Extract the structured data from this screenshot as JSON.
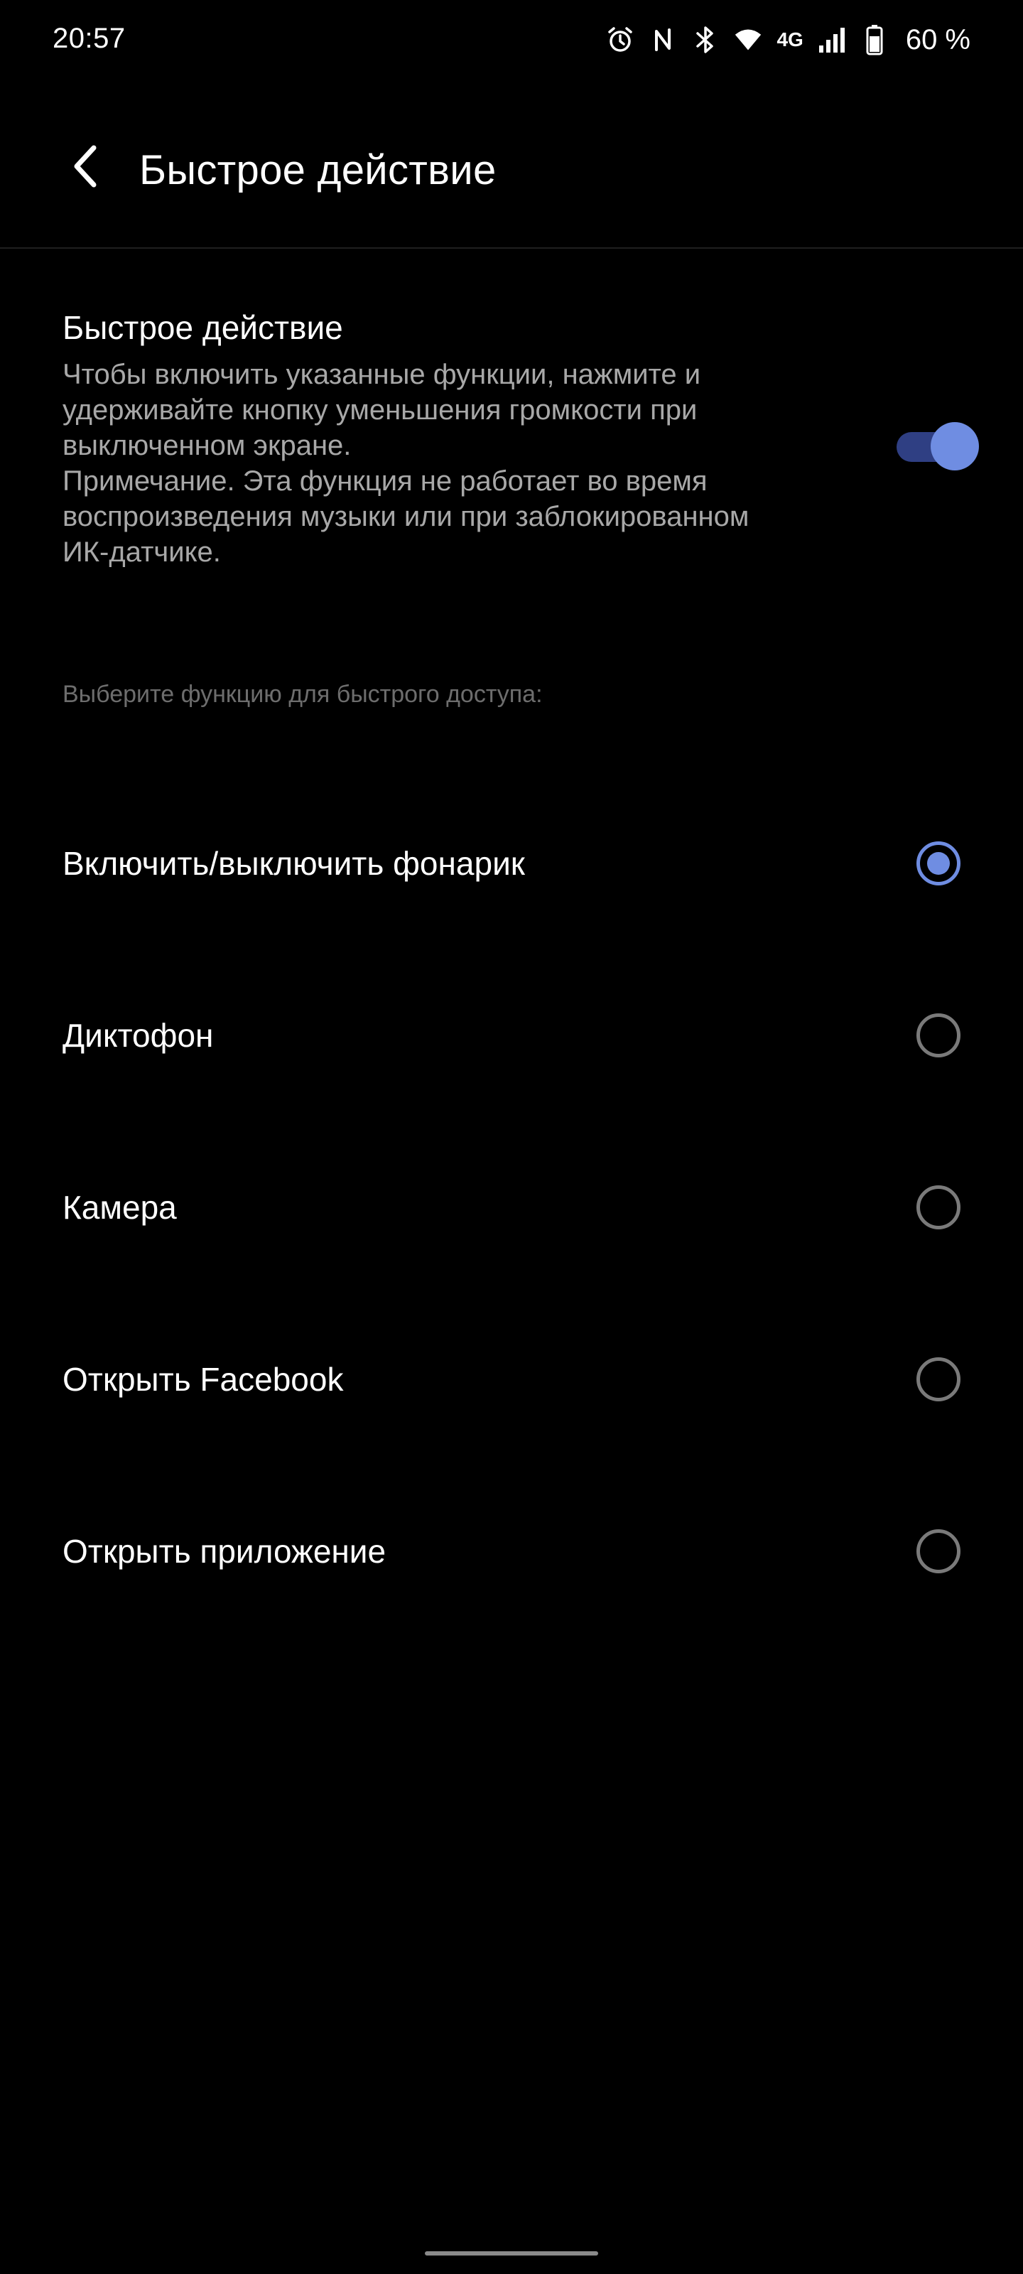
{
  "status_bar": {
    "time": "20:57",
    "network_type": "4G",
    "battery_percent": "60 %",
    "icons": [
      "alarm-icon",
      "nfc-icon",
      "bluetooth-icon",
      "wifi-icon",
      "signal-icon",
      "battery-icon"
    ]
  },
  "header": {
    "title": "Быстрое действие",
    "back_icon": "back-arrow-icon"
  },
  "quick_action": {
    "title": "Быстрое действие",
    "description": "Чтобы включить указанные функции, нажмите и удерживайте кнопку уменьшения громкости при выключенном экране.\nПримечание. Эта функция не работает во время воспроизведения музыки или при заблокированном ИК-датчике.",
    "enabled": true
  },
  "subheader": "Выберите функцию для быстрого доступа:",
  "options": [
    {
      "label": "Включить/выключить фонарик",
      "selected": true
    },
    {
      "label": "Диктофон",
      "selected": false
    },
    {
      "label": "Камера",
      "selected": false
    },
    {
      "label": "Открыть Facebook",
      "selected": false
    },
    {
      "label": "Открыть приложение",
      "selected": false
    }
  ],
  "colors": {
    "background": "#000000",
    "accent": "#6f8de2",
    "toggle_track": "#2f3f83",
    "secondary_text": "#a8a8a8",
    "radio_unchecked": "#7a7a7a"
  }
}
